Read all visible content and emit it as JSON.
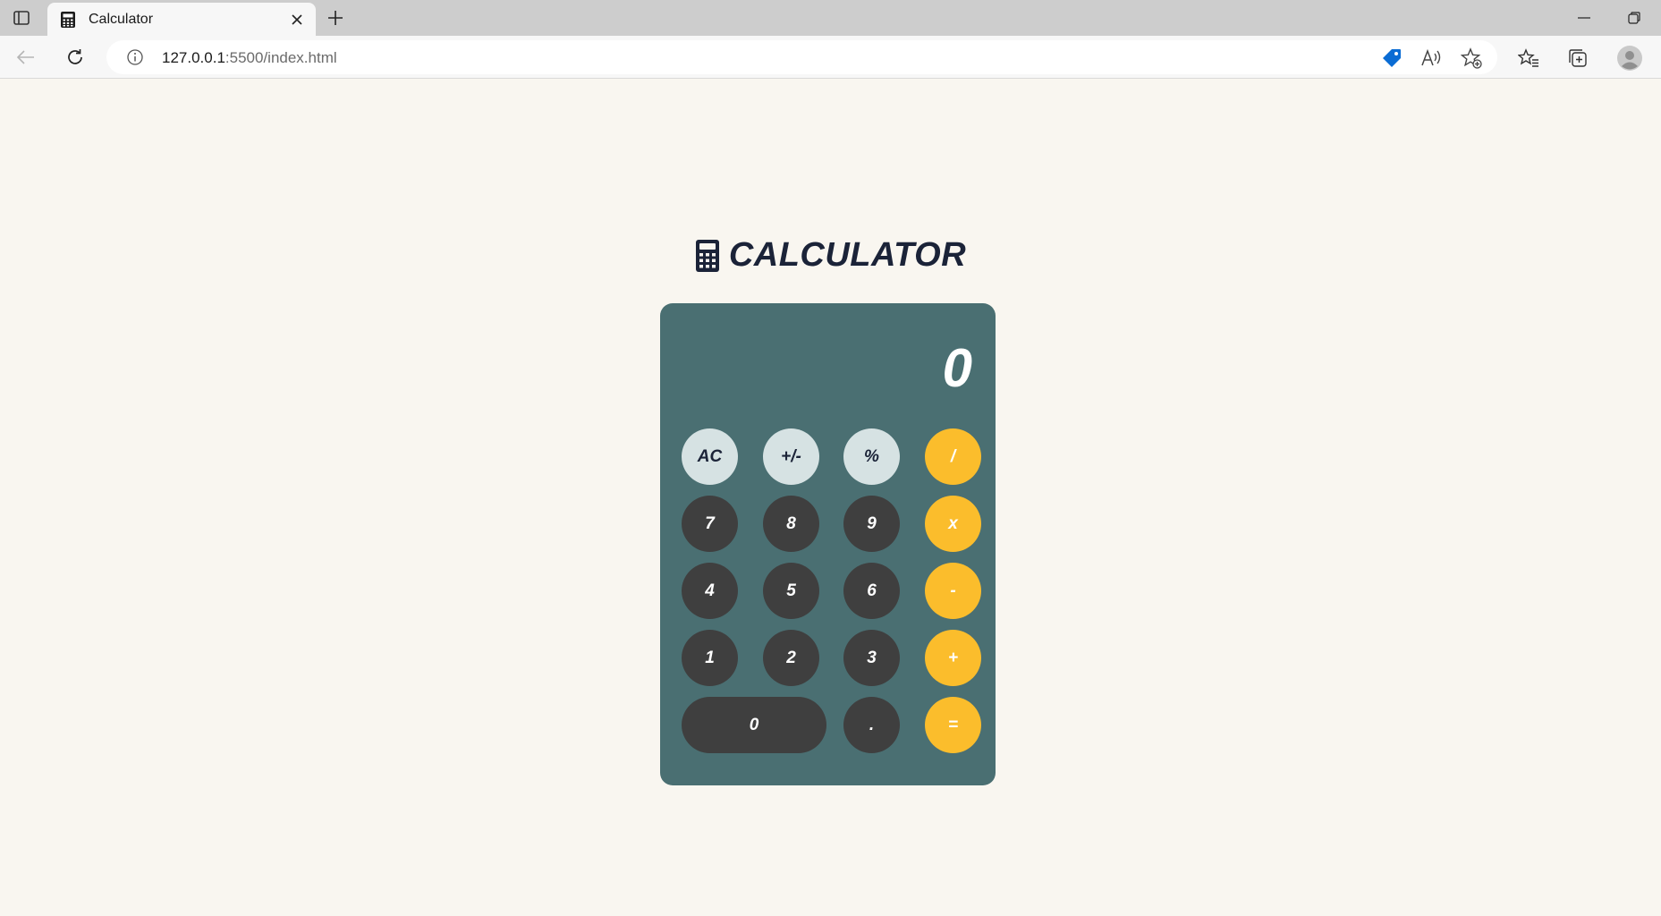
{
  "browser": {
    "tab_title": "Calculator",
    "url_host": "127.0.0.1",
    "url_path": ":5500/index.html"
  },
  "page": {
    "title": "CALCULATOR",
    "title_icon": "calculator-icon"
  },
  "calculator": {
    "display_value": "0",
    "keys": {
      "ac": "AC",
      "sign": "+/-",
      "percent": "%",
      "divide": "/",
      "seven": "7",
      "eight": "8",
      "nine": "9",
      "multiply": "x",
      "four": "4",
      "five": "5",
      "six": "6",
      "subtract": "-",
      "one": "1",
      "two": "2",
      "three": "3",
      "add": "+",
      "zero": "0",
      "decimal": ".",
      "equals": "="
    }
  },
  "colors": {
    "page_background": "#f9f6f0",
    "calculator_body": "#4a6f72",
    "key_light": "#d6e2e3",
    "key_dark": "#3f3f3f",
    "key_operator": "#fbbd2c",
    "title_text": "#1b2338"
  }
}
